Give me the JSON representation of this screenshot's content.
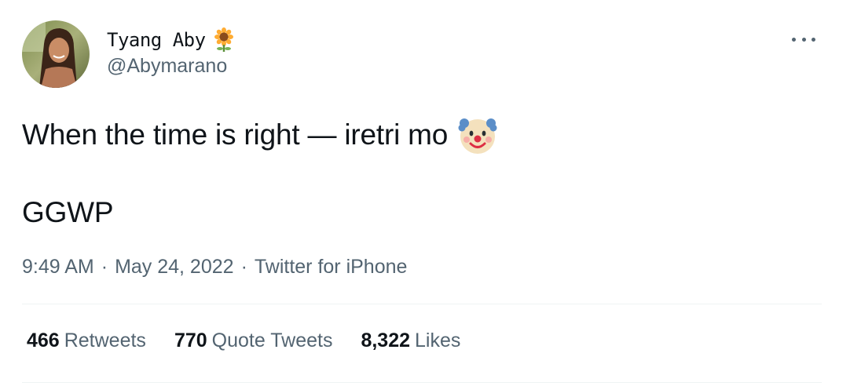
{
  "user": {
    "display_name": "Tyang Aby",
    "name_emoji": "sunflower-icon",
    "handle": "@Abymarano"
  },
  "tweet": {
    "line1": "When the time is right — iretri mo",
    "line1_emoji": "clown-face-icon",
    "line2": "GGWP"
  },
  "meta": {
    "time": "9:49 AM",
    "separator": "·",
    "date": "May 24, 2022",
    "source": "Twitter for iPhone"
  },
  "stats": {
    "retweets_count": "466",
    "retweets_label": "Retweets",
    "quotes_count": "770",
    "quotes_label": "Quote Tweets",
    "likes_count": "8,322",
    "likes_label": "Likes"
  },
  "colors": {
    "text_primary": "#0f1419",
    "text_secondary": "#536471",
    "divider": "#eff3f4"
  }
}
